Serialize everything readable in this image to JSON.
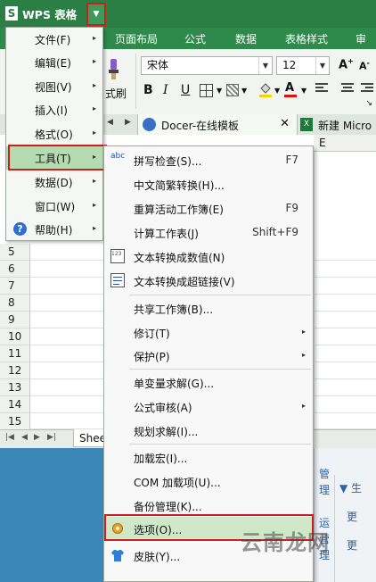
{
  "app": {
    "name": "WPS 表格",
    "logo_letter": "S"
  },
  "ribbon_tabs": [
    "页面布局",
    "公式",
    "数据",
    "表格样式",
    "审阅"
  ],
  "ribbon": {
    "format_brush_label": "式刷",
    "font_name": "宋体",
    "font_size": "12",
    "bold": "B",
    "italic": "I",
    "underline": "U"
  },
  "doc_tabs": {
    "docer": "Docer-在线模板",
    "new": "新建 Micro"
  },
  "column_header_visible": "E",
  "row_numbers": [
    "5",
    "6",
    "7",
    "8",
    "9",
    "10",
    "11",
    "12",
    "13",
    "14",
    "15"
  ],
  "sheet_tab": "Shee",
  "main_menu": [
    {
      "label": "文件(F)",
      "arrow": "▸"
    },
    {
      "label": "编辑(E)",
      "arrow": "▸"
    },
    {
      "label": "视图(V)",
      "arrow": "▸"
    },
    {
      "label": "插入(I)",
      "arrow": "▸"
    },
    {
      "label": "格式(O)",
      "arrow": "▸"
    },
    {
      "label": "工具(T)",
      "arrow": "▸"
    },
    {
      "label": "数据(D)",
      "arrow": "▸"
    },
    {
      "label": "窗口(W)",
      "arrow": "▸"
    },
    {
      "label": "帮助(H)",
      "arrow": "▸"
    }
  ],
  "tools_menu": [
    {
      "label": "拼写检查(S)...",
      "shortcut": "F7"
    },
    {
      "label": "中文简繁转换(H)..."
    },
    {
      "label": "重算活动工作簿(E)",
      "shortcut": "F9"
    },
    {
      "label": "计算工作表(J)",
      "shortcut": "Shift+F9"
    },
    {
      "label": "文本转换成数值(N)"
    },
    {
      "label": "文本转换成超链接(V)"
    },
    {
      "label": "共享工作簿(B)..."
    },
    {
      "label": "修订(T)",
      "arrow": "▸"
    },
    {
      "label": "保护(P)",
      "arrow": "▸"
    },
    {
      "label": "单变量求解(G)..."
    },
    {
      "label": "公式审核(A)",
      "arrow": "▸"
    },
    {
      "label": "规划求解(I)..."
    },
    {
      "label": "加载宏(I)..."
    },
    {
      "label": "COM 加载项(U)..."
    },
    {
      "label": "备份管理(K)..."
    },
    {
      "label": "选项(O)..."
    },
    {
      "label": "皮肤(Y)..."
    }
  ],
  "icons": {
    "spell": "abc",
    "num_icon": "123"
  },
  "right_pane": {
    "c1": "管",
    "c2": "理",
    "c3": "运",
    "c4": "营",
    "c5": "理",
    "r1": "▼ 生",
    "r2": "更",
    "r3": "更"
  },
  "watermark": "云南龙网",
  "colors": {
    "brand_green": "#2c7f44",
    "highlight": "#b6dbb0",
    "callout_red": "#cc1f1f"
  }
}
